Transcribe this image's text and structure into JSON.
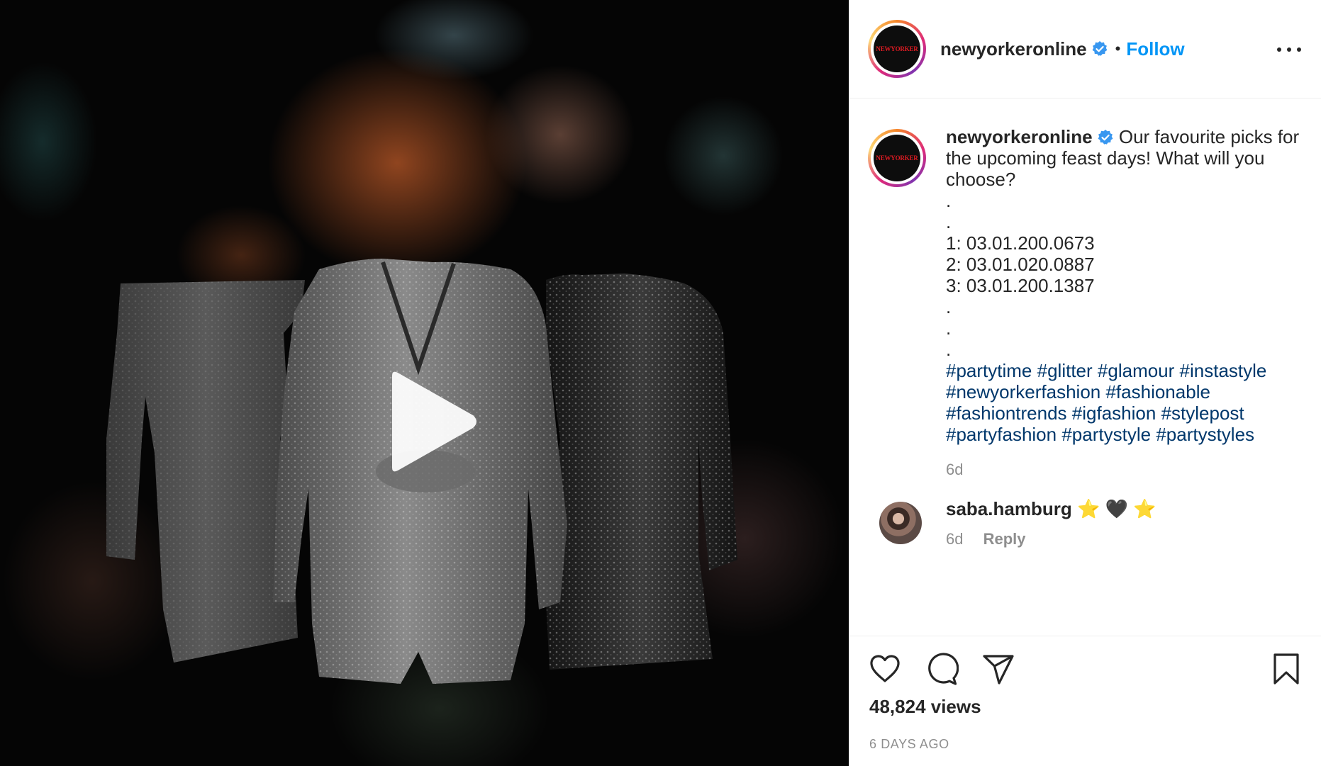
{
  "post": {
    "account": {
      "username": "newyorkeronline",
      "logo_text": "NEWYORKER",
      "verified": true,
      "follow_label": "Follow",
      "separator": "•"
    },
    "caption": {
      "lead": "Our favourite picks for the upcoming feast days! What will you choose?",
      "dot_lines": [
        "."
      ],
      "dot_lines_after": [
        "."
      ],
      "items": [
        "1: 03.01.200.0673",
        "2: 03.01.020.0887",
        "3: 03.01.200.1387"
      ],
      "hashtags": [
        "#partytime",
        "#glitter",
        "#glamour",
        "#instastyle",
        "#newyorkerfashion",
        "#fashionable",
        "#fashiontrends",
        "#igfashion",
        "#stylepost",
        "#partyfashion",
        "#partystyle",
        "#partystyles"
      ],
      "age": "6d"
    },
    "comments": [
      {
        "username": "saba.hamburg",
        "text": "⭐️ 🖤 ⭐️",
        "age": "6d",
        "reply_label": "Reply"
      }
    ],
    "stats": {
      "views": "48,824 views",
      "posted": "6 DAYS AGO"
    }
  },
  "media": {
    "type": "video",
    "icon": "play-icon"
  },
  "icons": {
    "like": "heart-icon",
    "comment": "comment-icon",
    "share": "share-icon",
    "save": "bookmark-icon",
    "more": "more-icon",
    "verified": "verified-badge-icon"
  },
  "colors": {
    "follow": "#0095f6",
    "hashtag": "#00376b",
    "verified": "#3897f0",
    "muted": "#8e8e8e"
  }
}
